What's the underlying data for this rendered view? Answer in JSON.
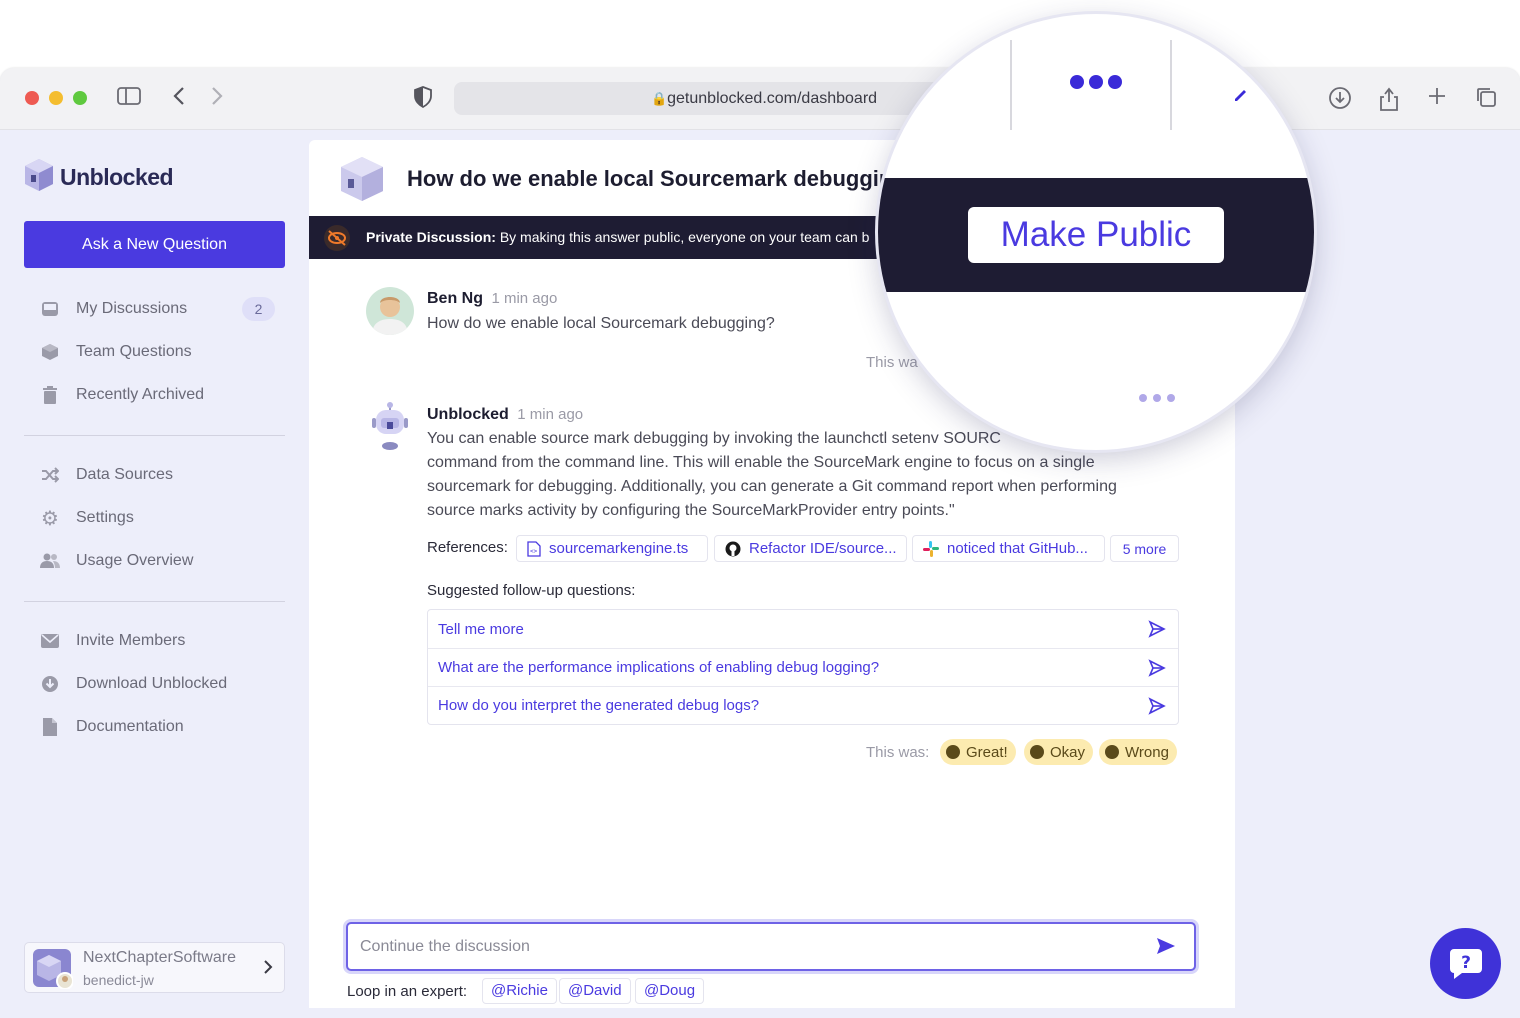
{
  "browser": {
    "url": "getunblocked.com/dashboard"
  },
  "sidebar": {
    "logo": "Unblocked",
    "ask_button": "Ask a New Question",
    "group1": [
      {
        "label": "My Discussions",
        "icon": "inbox-icon",
        "badge": "2"
      },
      {
        "label": "Team Questions",
        "icon": "cube-icon"
      },
      {
        "label": "Recently Archived",
        "icon": "trash-icon"
      }
    ],
    "group2": [
      {
        "label": "Data Sources",
        "icon": "shuffle-icon"
      },
      {
        "label": "Settings",
        "icon": "gear-icon"
      },
      {
        "label": "Usage Overview",
        "icon": "users-icon"
      }
    ],
    "group3": [
      {
        "label": "Invite Members",
        "icon": "mail-icon"
      },
      {
        "label": "Download Unblocked",
        "icon": "download-icon"
      },
      {
        "label": "Documentation",
        "icon": "document-icon"
      }
    ],
    "team": {
      "name": "NextChapterSoftware",
      "user": "benedict-jw"
    }
  },
  "discussion": {
    "title": "How do we enable local Sourcemark debugging?",
    "private_label": "Private Discussion:",
    "private_text": "By making this answer public, everyone on your team can b",
    "question": {
      "author": "Ben Ng",
      "time": "1 min ago",
      "text": "How do we enable local Sourcemark debugging?"
    },
    "partial_rating_label": "This wa",
    "answer": {
      "author": "Unblocked",
      "time": "1 min ago",
      "lines": [
        "You can enable source mark debugging by invoking the launchctl setenv SOURC",
        "command from the command line. This will enable the SourceMark engine to focus on a single",
        "sourcemark for debugging. Additionally, you can generate a Git command report when performing",
        "source marks activity by configuring the SourceMarkProvider entry points.\""
      ],
      "references_label": "References:",
      "references": [
        {
          "label": "sourcemarkengine.ts",
          "icon": "file-code-icon"
        },
        {
          "label": "Refactor IDE/source...",
          "icon": "github-icon"
        },
        {
          "label": "noticed that GitHub...",
          "icon": "slack-icon"
        }
      ],
      "more_refs": "5 more"
    },
    "followups_label": "Suggested follow-up questions:",
    "followups": [
      "Tell me more",
      "What are the performance implications of enabling debug logging?",
      "How do you interpret the generated debug logs?"
    ],
    "rating_label": "This was:",
    "ratings": [
      "Great!",
      "Okay",
      "Wrong"
    ],
    "input_placeholder": "Continue the discussion",
    "loop_label": "Loop in an expert:",
    "experts": [
      "@Richie",
      "@David",
      "@Doug"
    ]
  },
  "zoom": {
    "make_public": "Make Public"
  },
  "colors": {
    "accent": "#4a3ae0",
    "dark_bar": "#1e1c33",
    "sidebar_bg": "#edeefa",
    "rating_bg": "#fcebb0"
  }
}
